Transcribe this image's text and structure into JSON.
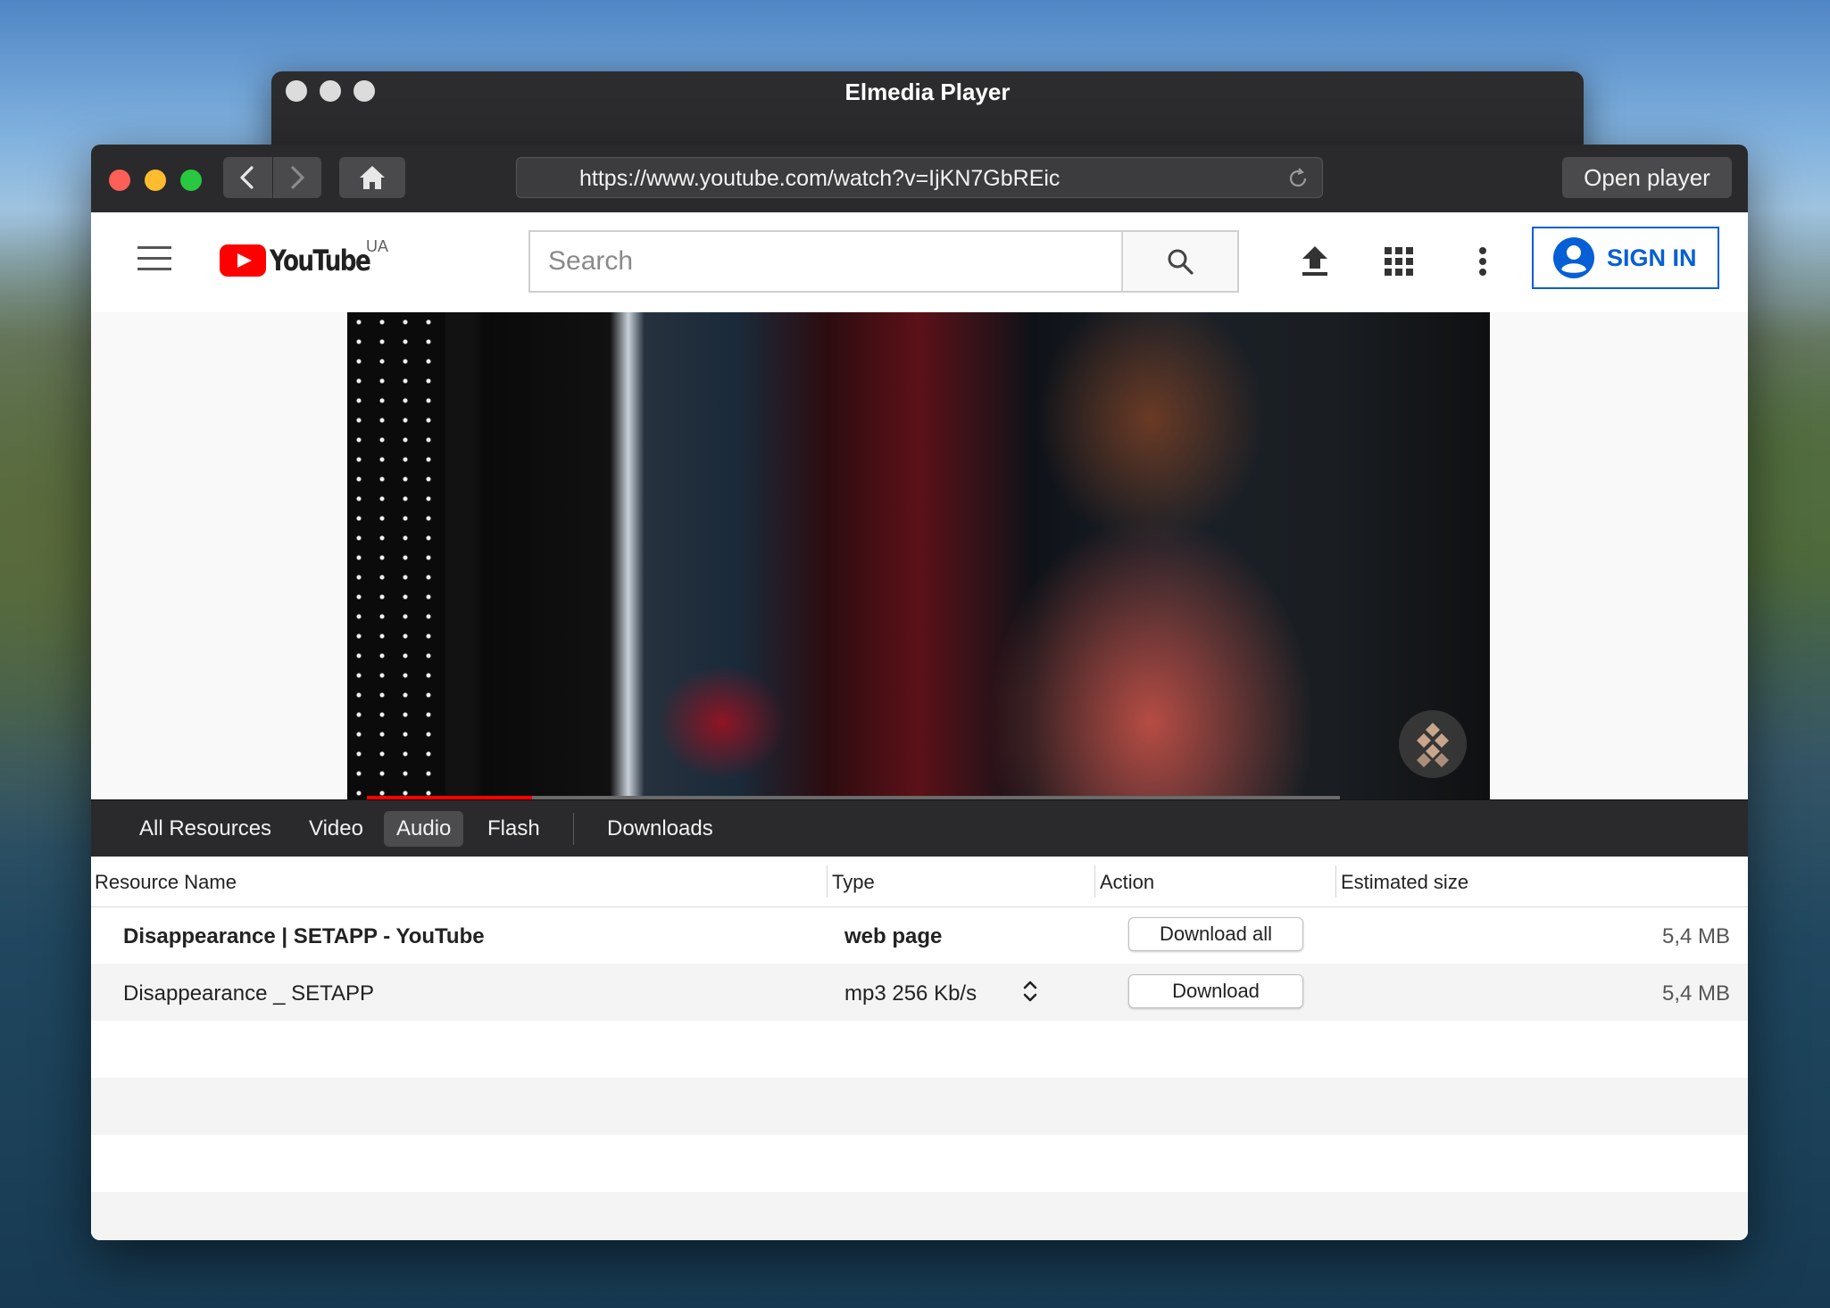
{
  "back_window": {
    "title": "Elmedia Player"
  },
  "toolbar": {
    "url": "https://www.youtube.com/watch?v=IjKN7GbREic",
    "open_player_label": "Open player"
  },
  "youtube": {
    "logo_text": "YouTube",
    "country": "UA",
    "search_placeholder": "Search",
    "sign_in_label": "SIGN IN",
    "video_progress_fraction": 0.17
  },
  "resource_tabs": [
    {
      "label": "All Resources",
      "active": false
    },
    {
      "label": "Video",
      "active": false
    },
    {
      "label": "Audio",
      "active": true
    },
    {
      "label": "Flash",
      "active": false
    },
    {
      "label": "Downloads",
      "active": false
    }
  ],
  "table": {
    "columns": [
      "Resource Name",
      "Type",
      "Action",
      "Estimated size"
    ],
    "rows": [
      {
        "name": "Disappearance | SETAPP - YouTube",
        "type": "web page",
        "action": "Download all",
        "size": "5,4 MB"
      },
      {
        "name": "Disappearance _ SETAPP",
        "type": "mp3 256 Kb/s",
        "action": "Download",
        "size": "5,4 MB"
      }
    ]
  },
  "colors": {
    "accent_blue": "#065fd4",
    "youtube_red": "#ff0000",
    "toolbar_dark": "#2a2a2c"
  }
}
